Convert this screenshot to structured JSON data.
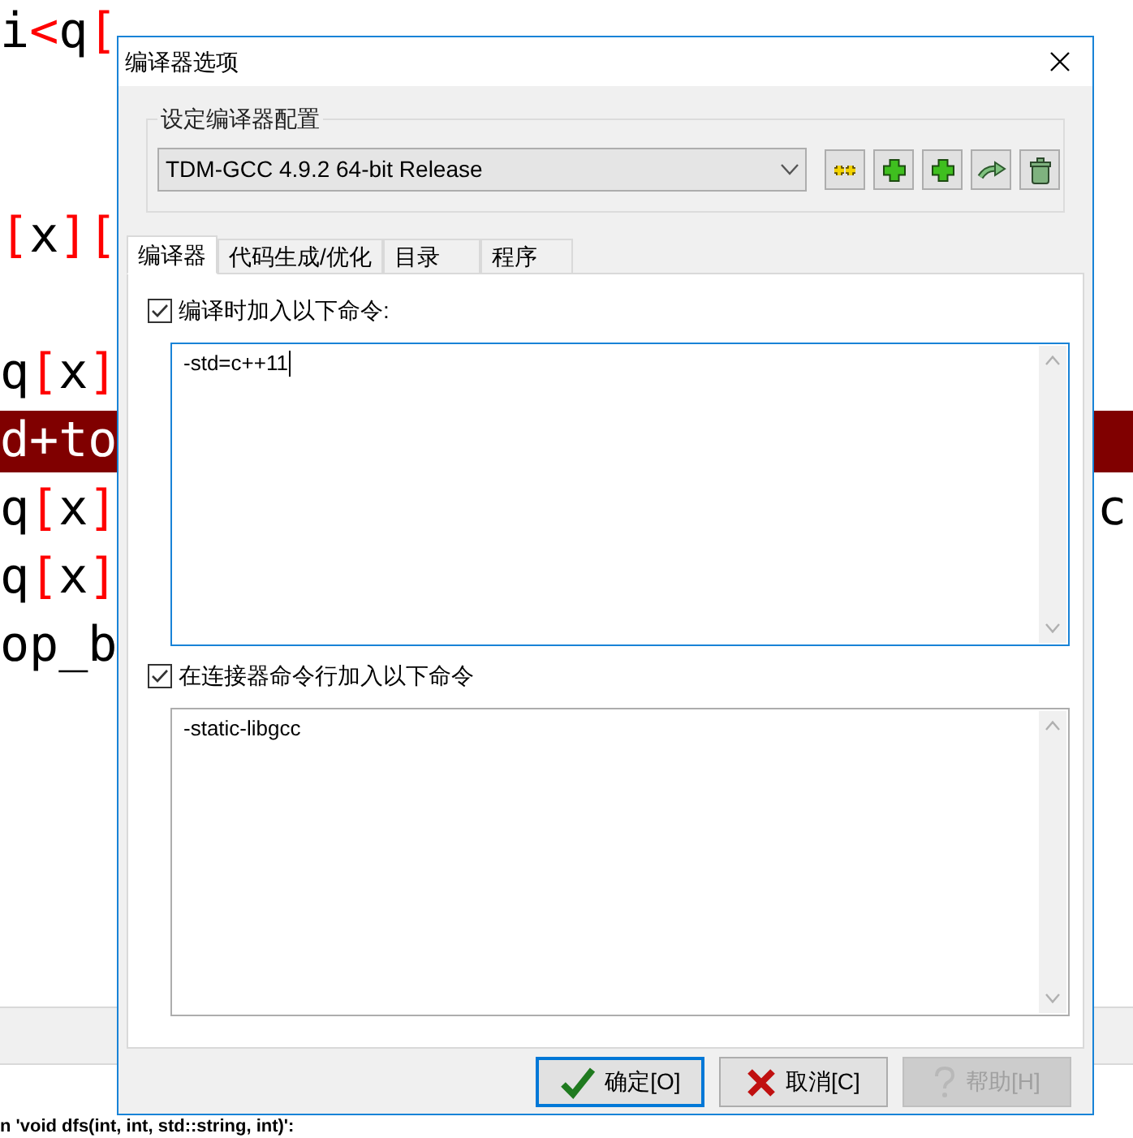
{
  "editor": {
    "lines": [
      {
        "segments": [
          {
            "kind": "plain",
            "text": "i"
          },
          {
            "kind": "operator",
            "text": "<"
          },
          {
            "kind": "plain",
            "text": "q"
          },
          {
            "kind": "bracket",
            "text": "["
          }
        ],
        "highlighted": false
      },
      {
        "segments": [
          {
            "kind": "bracket",
            "text": "["
          },
          {
            "kind": "plain",
            "text": "x"
          },
          {
            "kind": "bracket",
            "text": "]["
          }
        ],
        "highlighted": false
      },
      {
        "segments": [
          {
            "kind": "plain",
            "text": "q"
          },
          {
            "kind": "bracket",
            "text": "["
          },
          {
            "kind": "plain",
            "text": "x"
          },
          {
            "kind": "bracket",
            "text": "]"
          }
        ],
        "highlighted": false
      },
      {
        "segments": [
          {
            "kind": "plain",
            "text": "d+to"
          }
        ],
        "highlighted": true
      },
      {
        "segments": [
          {
            "kind": "plain",
            "text": "q"
          },
          {
            "kind": "bracket",
            "text": "["
          },
          {
            "kind": "plain",
            "text": "x"
          },
          {
            "kind": "bracket",
            "text": "]"
          }
        ],
        "right": "c",
        "highlighted": false
      },
      {
        "segments": [
          {
            "kind": "plain",
            "text": "q"
          },
          {
            "kind": "bracket",
            "text": "["
          },
          {
            "kind": "plain",
            "text": "x"
          },
          {
            "kind": "bracket",
            "text": "]"
          }
        ],
        "highlighted": false
      },
      {
        "segments": [
          {
            "kind": "plain",
            "text": "op_b"
          }
        ],
        "highlighted": false
      }
    ]
  },
  "message": "n 'void dfs(int, int, std::string, int)':",
  "dialog": {
    "title": "编译器选项",
    "config_group": {
      "label": "设定编译器配置",
      "selected_config": "TDM-GCC 4.9.2 64-bit Release"
    },
    "tabs": [
      {
        "label": "编译器",
        "selected": true
      },
      {
        "label": "代码生成/优化",
        "selected": false
      },
      {
        "label": "目录",
        "selected": false
      },
      {
        "label": "程序",
        "selected": false
      }
    ],
    "options": [
      {
        "label": "编译时加入以下命令:",
        "checked": true,
        "value": "-std=c++11",
        "focused": true
      },
      {
        "label": "在连接器命令行加入以下命令",
        "checked": true,
        "value": "-static-libgcc",
        "focused": false
      }
    ],
    "buttons": [
      {
        "kind": "ok",
        "label": "确定[O]",
        "disabled": false,
        "default": true
      },
      {
        "kind": "cancel",
        "label": "取消[C]",
        "disabled": false,
        "default": false
      },
      {
        "kind": "help",
        "label": "帮助[H]",
        "disabled": true,
        "default": false
      }
    ]
  }
}
